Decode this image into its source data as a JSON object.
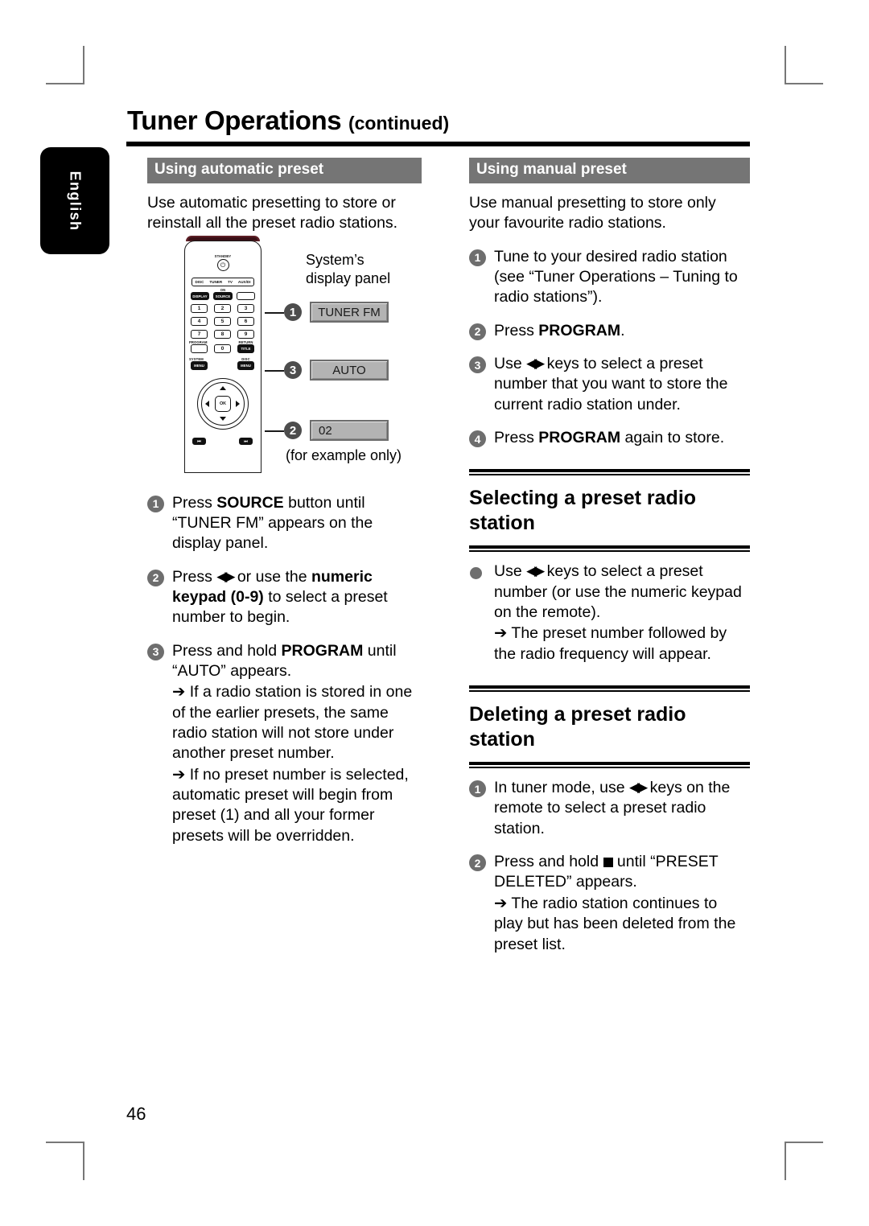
{
  "page": {
    "title_main": "Tuner Operations",
    "title_continued": "(continued)",
    "language_tab": "English",
    "page_number": "46"
  },
  "left_column": {
    "section_bar": "Using automatic preset",
    "intro": "Use automatic presetting to store or reinstall all the preset radio stations.",
    "steps": [
      {
        "num": "1",
        "parts": [
          {
            "t": "Press ",
            "b": false
          },
          {
            "t": "SOURCE",
            "b": true
          },
          {
            "t": " button until “TUNER FM” appears on the display panel.",
            "b": false
          }
        ]
      },
      {
        "num": "2",
        "parts": [
          {
            "t": "Press ",
            "b": false
          },
          {
            "t": "◀▶",
            "b": false,
            "icon": true
          },
          {
            "t": " or use the ",
            "b": false
          },
          {
            "t": "numeric keypad (0-9)",
            "b": true
          },
          {
            "t": " to select a preset number to begin.",
            "b": false
          }
        ]
      },
      {
        "num": "3",
        "parts": [
          {
            "t": "Press and hold ",
            "b": false
          },
          {
            "t": "PROGRAM",
            "b": true
          },
          {
            "t": " until “AUTO” appears.",
            "b": false
          }
        ],
        "subs": [
          "➔ If a radio station is stored in one of the earlier presets, the same radio station will not store under another preset number.",
          "➔ If no preset number is selected, automatic preset will begin from preset (1) and all your former presets will be overridden."
        ]
      }
    ]
  },
  "figure": {
    "caption_display_panel": "System’s display panel",
    "caption_example": "(for example only)",
    "display_boxes": [
      {
        "callout": "1",
        "text": "TUNER FM"
      },
      {
        "callout": "3",
        "text": "AUTO"
      },
      {
        "callout": "2",
        "text": "02"
      }
    ],
    "remote": {
      "standby_label": "STANDBY",
      "power_icon": "power-icon",
      "source_options": [
        "DISC",
        "TUNER",
        "TV",
        "AUX/DI"
      ],
      "display_key": "DISPLAY",
      "on_label": "ON",
      "source_key": "SOURCE",
      "keypad": [
        "1",
        "2",
        "3",
        "4",
        "5",
        "6",
        "7",
        "8",
        "9",
        "0"
      ],
      "program_label": "PROGRAM",
      "return_label": "RETURN",
      "title_key": "TITLE",
      "system_label": "SYSTEM",
      "system_menu_key": "MENU",
      "disc_label": "DISC",
      "disc_menu_key": "MENU",
      "ok_key": "OK",
      "prev_key": "⏮",
      "next_key": "⏭"
    }
  },
  "right_column": {
    "section_bar": "Using manual preset",
    "intro": "Use manual presetting to store only your favourite radio stations.",
    "steps": [
      {
        "num": "1",
        "parts": [
          {
            "t": "Tune to your desired radio station (see “Tuner Operations – Tuning to radio stations”).",
            "b": false
          }
        ]
      },
      {
        "num": "2",
        "parts": [
          {
            "t": "Press ",
            "b": false
          },
          {
            "t": "PROGRAM",
            "b": true
          },
          {
            "t": ".",
            "b": false
          }
        ]
      },
      {
        "num": "3",
        "parts": [
          {
            "t": "Use ",
            "b": false
          },
          {
            "t": "◀▶",
            "b": false,
            "icon": true
          },
          {
            "t": " keys to select a preset number that you want to store the current radio station under.",
            "b": false
          }
        ]
      },
      {
        "num": "4",
        "parts": [
          {
            "t": "Press ",
            "b": false
          },
          {
            "t": "PROGRAM",
            "b": true
          },
          {
            "t": " again to store.",
            "b": false
          }
        ]
      }
    ],
    "section_selecting": {
      "heading": "Selecting a preset radio station",
      "bullet_parts": [
        {
          "t": "Use ",
          "b": false
        },
        {
          "t": "◀▶",
          "b": false,
          "icon": true
        },
        {
          "t": " keys to select a preset number (or use the numeric keypad on the remote).",
          "b": false
        }
      ],
      "sub": "➔ The preset number followed by the radio frequency will appear."
    },
    "section_deleting": {
      "heading": "Deleting a preset radio station",
      "steps": [
        {
          "num": "1",
          "parts": [
            {
              "t": "In tuner mode, use ",
              "b": false
            },
            {
              "t": "◀▶",
              "b": false,
              "icon": true
            },
            {
              "t": " keys on the remote to select a preset radio station.",
              "b": false
            }
          ]
        },
        {
          "num": "2",
          "parts": [
            {
              "t": "Press and hold ",
              "b": false
            },
            {
              "t": "■",
              "b": false,
              "square": true
            },
            {
              "t": " until “PRESET DELETED” appears.",
              "b": false
            }
          ],
          "subs": [
            "➔ The radio station continues to play but has been deleted from the preset list."
          ]
        }
      ]
    }
  },
  "colors": {
    "section_bar": "#757575",
    "badge": "#6e6e6e",
    "callout": "#4d4d4d",
    "display_box": "#b3b3b3",
    "remote_accent": "#5d1f26"
  }
}
